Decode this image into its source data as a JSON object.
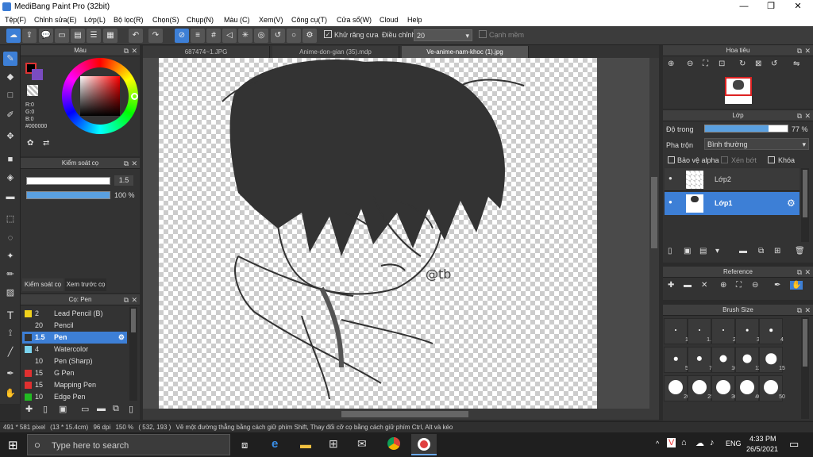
{
  "window": {
    "title": "MediBang Paint Pro (32bit)",
    "minimize": "—",
    "maximize": "❐",
    "close": "✕"
  },
  "menu": [
    "Tệp(F)",
    "Chỉnh sửa(E)",
    "Lớp(L)",
    "Bộ lọc(R)",
    "Chọn(S)",
    "Chụp(N)",
    "Màu (C)",
    "Xem(V)",
    "Công cụ(T)",
    "Cửa sổ(W)",
    "Cloud",
    "Help"
  ],
  "toolbar": {
    "antialias_label": "Khử răng cưa",
    "adjust_label": "Điều chỉnh",
    "adjust_value": "20",
    "snap_label": "Cạnh mềm"
  },
  "color_panel": {
    "title": "Màu",
    "r": "R:0",
    "g": "G:0",
    "b": "B:0",
    "hex": "#000000"
  },
  "brush_control": {
    "title": "Kiểm soát cọ",
    "size": "1.5",
    "opacity": "100 %",
    "tab1": "Kiểm soát cọ",
    "tab2": "Xem trước cọ",
    "opacity_value": 1.0
  },
  "brush_panel": {
    "title": "Cọ: Pen",
    "brushes": [
      {
        "size": "2",
        "name": "Lead Pencil (B)",
        "color": "#f1d21c"
      },
      {
        "size": "20",
        "name": "Pencil",
        "color": "#333333"
      },
      {
        "size": "1.5",
        "name": "Pen",
        "color": "#333333"
      },
      {
        "size": "4",
        "name": "Watercolor",
        "color": "#7ad3ee"
      },
      {
        "size": "10",
        "name": "Pen (Sharp)",
        "color": "#333333"
      },
      {
        "size": "15",
        "name": "G Pen",
        "color": "#e03030"
      },
      {
        "size": "15",
        "name": "Mapping Pen",
        "color": "#e03030"
      },
      {
        "size": "10",
        "name": "Edge Pen",
        "color": "#22bb22"
      }
    ]
  },
  "tabs": [
    "687474~1.JPG",
    "Anime-don-gian (35).mdp",
    "Ve-anime-nam-khoc (1).jpg"
  ],
  "navigator": {
    "title": "Hoa tiêu"
  },
  "layer_panel": {
    "title": "Lớp",
    "opacity_label": "Độ trong",
    "opacity_value": "77 %",
    "opacity_level": 0.77,
    "blend_label": "Pha trộn",
    "blend_value": "Bình thường",
    "protect_alpha": "Bảo vệ alpha",
    "clip": "Xén bớt",
    "lock": "Khóa",
    "layers": [
      {
        "name": "Lớp2"
      },
      {
        "name": "Lớp1"
      }
    ]
  },
  "reference": {
    "title": "Reference"
  },
  "brush_size": {
    "title": "Brush Size",
    "sizes": [
      "1",
      "1.5",
      "2",
      "3",
      "4",
      "5",
      "7",
      "10",
      "12",
      "15",
      "20",
      "25",
      "30",
      "40",
      "50"
    ]
  },
  "canvas_text": "@tb",
  "status": {
    "dims": "491 * 581 pixel",
    "cm": "(13 * 15.4cm)",
    "dpi": "96 dpi",
    "zoom": "150 %",
    "coords": "( 532, 193 )",
    "hint": "Vẽ một đường thẳng bằng cách giữ phím Shift, Thay đổi cỡ cọ bằng cách giữ phím Ctrl, Alt và kéo"
  },
  "taskbar": {
    "search_placeholder": "Type here to search",
    "lang": "ENG",
    "time": "4:33 PM",
    "date": "26/5/2021"
  }
}
